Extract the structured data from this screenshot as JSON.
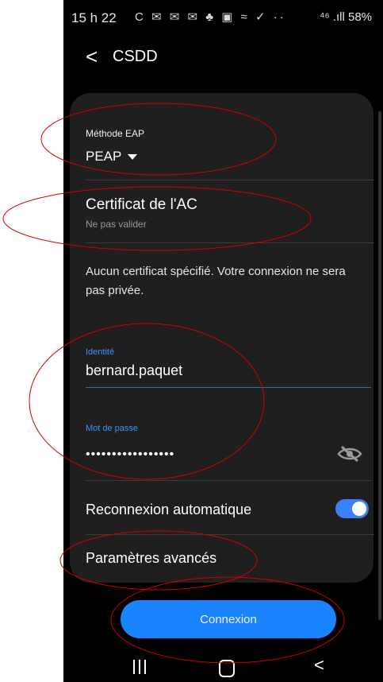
{
  "status_bar": {
    "time": "15 h 22",
    "notification_icons": "C ✉ ✉ ✉ ♣ ▣ ≈ ✓ ··",
    "right": "⁴⁶ .ıll 58%"
  },
  "header": {
    "title": "CSDD"
  },
  "eap": {
    "label": "Méthode EAP",
    "value": "PEAP"
  },
  "certificate": {
    "title": "Certificat de l'AC",
    "value": "Ne pas valider"
  },
  "info_text": "Aucun certificat spécifié. Votre connexion ne sera pas privée.",
  "identity": {
    "label": "Identité",
    "value": "bernard.paquet"
  },
  "password": {
    "label": "Mot de passe",
    "value": "•••••••••••••••••"
  },
  "auto_reconnect": {
    "label": "Reconnexion automatique",
    "enabled": true
  },
  "advanced": {
    "label": "Paramètres avancés"
  },
  "connect_button": {
    "label": "Connexion"
  },
  "colors": {
    "accent": "#1a84ff",
    "annotation": "#d00000",
    "card": "#1f1f1f"
  }
}
